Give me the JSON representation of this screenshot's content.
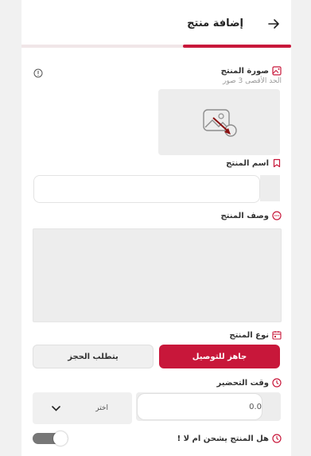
{
  "header": {
    "title": "إضافة منتج",
    "progress": 0.4,
    "accent_color": "#c8173a"
  },
  "product_image": {
    "label": "صورة المنتج",
    "hint": "الحد الأقصى 3 صور",
    "icon": "image-icon"
  },
  "product_name": {
    "label": "اسم المنتج",
    "value": ""
  },
  "product_description": {
    "label": "وصف المنتج",
    "value": ""
  },
  "product_type": {
    "label": "نوع المنتج",
    "options": [
      "جاهز للتوصيل",
      "يتطلب الحجز"
    ],
    "selected": "جاهز للتوصيل"
  },
  "prep_time": {
    "label": "وقت التحضير",
    "value": "0.0",
    "unit_placeholder": "اختر"
  },
  "shipping": {
    "label": "هل المنتج يشحن ام لا !",
    "enabled": true
  }
}
